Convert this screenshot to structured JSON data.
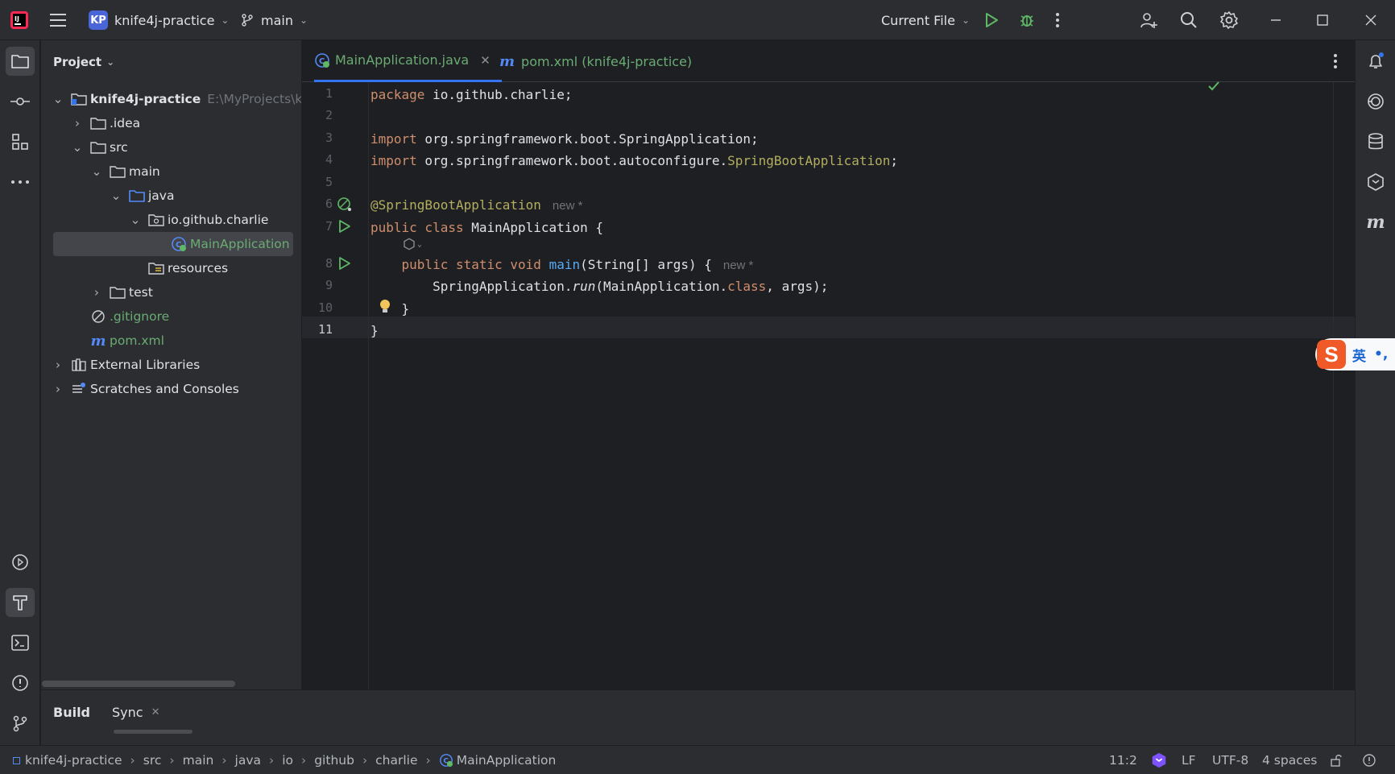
{
  "titlebar": {
    "project_badge": "KP",
    "project_name": "knife4j-practice",
    "branch": "main",
    "run_config": "Current File"
  },
  "project_panel": {
    "title": "Project",
    "tree": [
      {
        "label": "knife4j-practice",
        "hint": "E:\\MyProjects\\knif",
        "depth": 0,
        "expanded": true,
        "type": "module"
      },
      {
        "label": ".idea",
        "depth": 1,
        "expanded": false,
        "type": "folder"
      },
      {
        "label": "src",
        "depth": 1,
        "expanded": true,
        "type": "folder"
      },
      {
        "label": "main",
        "depth": 2,
        "expanded": true,
        "type": "folder"
      },
      {
        "label": "java",
        "depth": 3,
        "expanded": true,
        "type": "source-folder"
      },
      {
        "label": "io.github.charlie",
        "depth": 4,
        "expanded": true,
        "type": "package"
      },
      {
        "label": "MainApplication",
        "depth": 5,
        "type": "class",
        "selected": true
      },
      {
        "label": "resources",
        "depth": 3,
        "type": "resources-folder"
      },
      {
        "label": "test",
        "depth": 2,
        "expanded": false,
        "type": "folder"
      },
      {
        "label": ".gitignore",
        "depth": 1,
        "type": "ignore-file"
      },
      {
        "label": "pom.xml",
        "depth": 1,
        "type": "maven-file"
      },
      {
        "label": "External Libraries",
        "depth": 0,
        "expanded": false,
        "type": "libraries"
      },
      {
        "label": "Scratches and Consoles",
        "depth": 0,
        "expanded": false,
        "type": "scratches"
      }
    ]
  },
  "editor": {
    "tabs": [
      {
        "label": "MainApplication.java",
        "active": true,
        "closable": true
      },
      {
        "label": "pom.xml (knife4j-practice)",
        "active": false
      }
    ],
    "line_numbers": [
      "1",
      "2",
      "3",
      "4",
      "5",
      "6",
      "7",
      "8",
      "9",
      "10",
      "11"
    ],
    "code": {
      "l1_kw": "package",
      "l1_rest": " io.github.charlie;",
      "l3_kw": "import",
      "l3_rest": " org.springframework.boot.SpringApplication;",
      "l4_kw": "import",
      "l4_rest": " org.springframework.boot.autoconfigure.",
      "l4_an": "SpringBootApplication",
      "l4_end": ";",
      "l6_an": "@SpringBootApplication",
      "l6_hint": "new *",
      "l7_kw": "public class",
      "l7_rest": " MainApplication {",
      "l8_kw": "public static void",
      "l8_fn": "main",
      "l8_rest": "(String[] args) {",
      "l8_hint": "new *",
      "l9_a": "SpringApplication.",
      "l9_run": "run",
      "l9_b": "(MainApplication.",
      "l9_class": "class",
      "l9_c": ", args);",
      "l10": "}",
      "l11": "}"
    }
  },
  "bottom_tabs": {
    "build": "Build",
    "sync": "Sync"
  },
  "statusbar": {
    "breadcrumbs": [
      "knife4j-practice",
      "src",
      "main",
      "java",
      "io",
      "github",
      "charlie",
      "MainApplication"
    ],
    "position": "11:2",
    "line_ending": "LF",
    "encoding": "UTF-8",
    "indent": "4 spaces"
  },
  "ime": {
    "logo": "S",
    "lang": "英",
    "punct": "•,"
  },
  "colors": {
    "accent": "#3574f0",
    "keyword": "#cf8e6d",
    "annotation": "#b3ae60",
    "function": "#57aaf7",
    "green_run": "#5fb865",
    "selected_text": "#6aab73"
  }
}
